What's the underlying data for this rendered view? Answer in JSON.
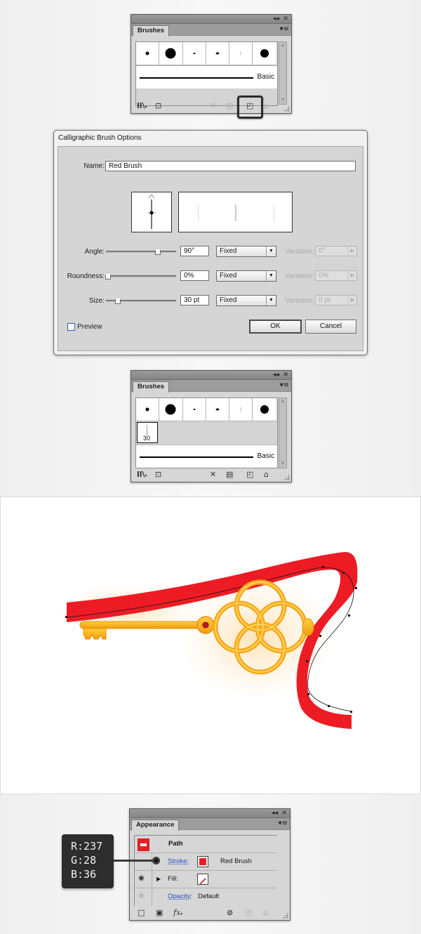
{
  "colors": {
    "ribbon_red": "#ed1c24",
    "key_gold": "#f7a81b",
    "link_blue": "#1d4fbf"
  },
  "brushes_panel_1": {
    "tab_label": "Brushes",
    "panel_controls": {
      "collapse": "◂◂",
      "close": "✕",
      "menu": "▾≡"
    },
    "brush_thumbnails": [
      "dot-small",
      "dot-large",
      "dot-tiny",
      "oval-small",
      "line-thin",
      "dot-large-2"
    ],
    "basic_label": "Basic",
    "footer_icons": [
      {
        "name": "brush-libraries-icon",
        "glyph": "ll\\▾",
        "enabled": true
      },
      {
        "name": "libraries-panel-icon",
        "glyph": "⊡",
        "enabled": true
      },
      {
        "name": "remove-brush-stroke-icon",
        "glyph": "✕",
        "enabled": false
      },
      {
        "name": "options-selected-object-icon",
        "glyph": "▤",
        "enabled": false
      },
      {
        "name": "new-brush-icon",
        "glyph": "◰",
        "enabled": true,
        "highlighted": true
      },
      {
        "name": "delete-brush-icon",
        "glyph": "🗑",
        "enabled": false
      }
    ]
  },
  "dialog": {
    "title": "Calligraphic Brush Options",
    "name_label": "Name:",
    "name_value": "Red Brush",
    "rows": [
      {
        "label": "Angle:",
        "value": "90°",
        "slider_fraction": 0.75,
        "mode": "Fixed",
        "variation_label": "Variation:",
        "variation_value": "0°"
      },
      {
        "label": "Roundness:",
        "value": "0%",
        "slider_fraction": 0.0,
        "mode": "Fixed",
        "variation_label": "Variation:",
        "variation_value": "0%"
      },
      {
        "label": "Size:",
        "value": "30 pt",
        "slider_fraction": 0.1,
        "mode": "Fixed",
        "variation_label": "Variation:",
        "variation_value": "0 pt"
      }
    ],
    "preview_label": "Preview",
    "preview_checked": false,
    "ok_label": "OK",
    "cancel_label": "Cancel"
  },
  "brushes_panel_2": {
    "tab_label": "Brushes",
    "new_brush_size_label": "30",
    "basic_label": "Basic",
    "footer_icons": [
      {
        "name": "brush-libraries-icon",
        "glyph": "ll\\▾",
        "enabled": true
      },
      {
        "name": "libraries-panel-icon",
        "glyph": "⊡",
        "enabled": true
      },
      {
        "name": "remove-brush-stroke-icon",
        "glyph": "✕",
        "enabled": true
      },
      {
        "name": "options-selected-object-icon",
        "glyph": "▤",
        "enabled": true
      },
      {
        "name": "new-brush-icon",
        "glyph": "◰",
        "enabled": true
      },
      {
        "name": "delete-brush-icon",
        "glyph": "🗑",
        "enabled": true
      }
    ]
  },
  "appearance_panel": {
    "tab_label": "Appearance",
    "object_label": "Path",
    "stroke_label": "Stroke:",
    "stroke_value": "Red Brush",
    "fill_label": "Fill:",
    "opacity_label": "Opacity:",
    "opacity_value": "Default",
    "footer_icons": [
      {
        "name": "add-new-stroke-icon",
        "glyph": "□",
        "enabled": true
      },
      {
        "name": "add-new-fill-icon",
        "glyph": "▣",
        "enabled": true
      },
      {
        "name": "add-new-effect-icon",
        "glyph": "fx▾",
        "enabled": true
      },
      {
        "name": "clear-appearance-icon",
        "glyph": "⊘",
        "enabled": true
      },
      {
        "name": "duplicate-item-icon",
        "glyph": "◰",
        "enabled": false
      },
      {
        "name": "delete-item-icon",
        "glyph": "🗑",
        "enabled": false
      }
    ]
  },
  "rgb_callout": {
    "r": "R:237",
    "g": "G:28",
    "b": "B:36"
  }
}
